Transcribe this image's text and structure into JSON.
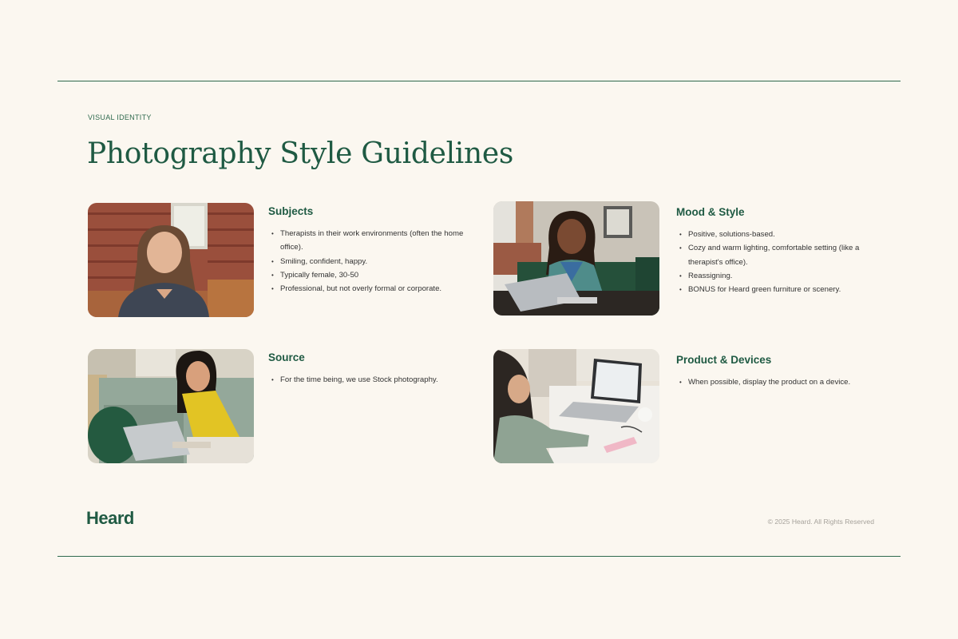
{
  "slide": {
    "eyebrow": "VISUAL IDENTITY",
    "title": "Photography Style Guidelines"
  },
  "sections": [
    {
      "heading": "Subjects",
      "bullets": [
        "Therapists in their work environments (often the home office).",
        "Smiling, confident, happy.",
        "Typically female, 30-50",
        "Professional, but not overly formal or corporate."
      ]
    },
    {
      "heading": "Mood & Style",
      "bullets": [
        "Positive, solutions-based.",
        "Cozy and warm lighting, comfortable setting (like a therapist's office).",
        "Reassigning.",
        "BONUS for Heard green furniture or scenery."
      ]
    },
    {
      "heading": "Source",
      "bullets": [
        "For the time being, we use Stock photography."
      ]
    },
    {
      "heading": "Product & Devices",
      "bullets": [
        "When possible, display the product on a device."
      ]
    }
  ],
  "footer": {
    "logo": "Heard",
    "copyright": "© 2025 Heard. All Rights Reserved"
  },
  "colors": {
    "background": "#fbf7f0",
    "brand_green": "#1f5a43",
    "rule_green": "#2f6a4e",
    "muted_text": "#a6a29b"
  }
}
